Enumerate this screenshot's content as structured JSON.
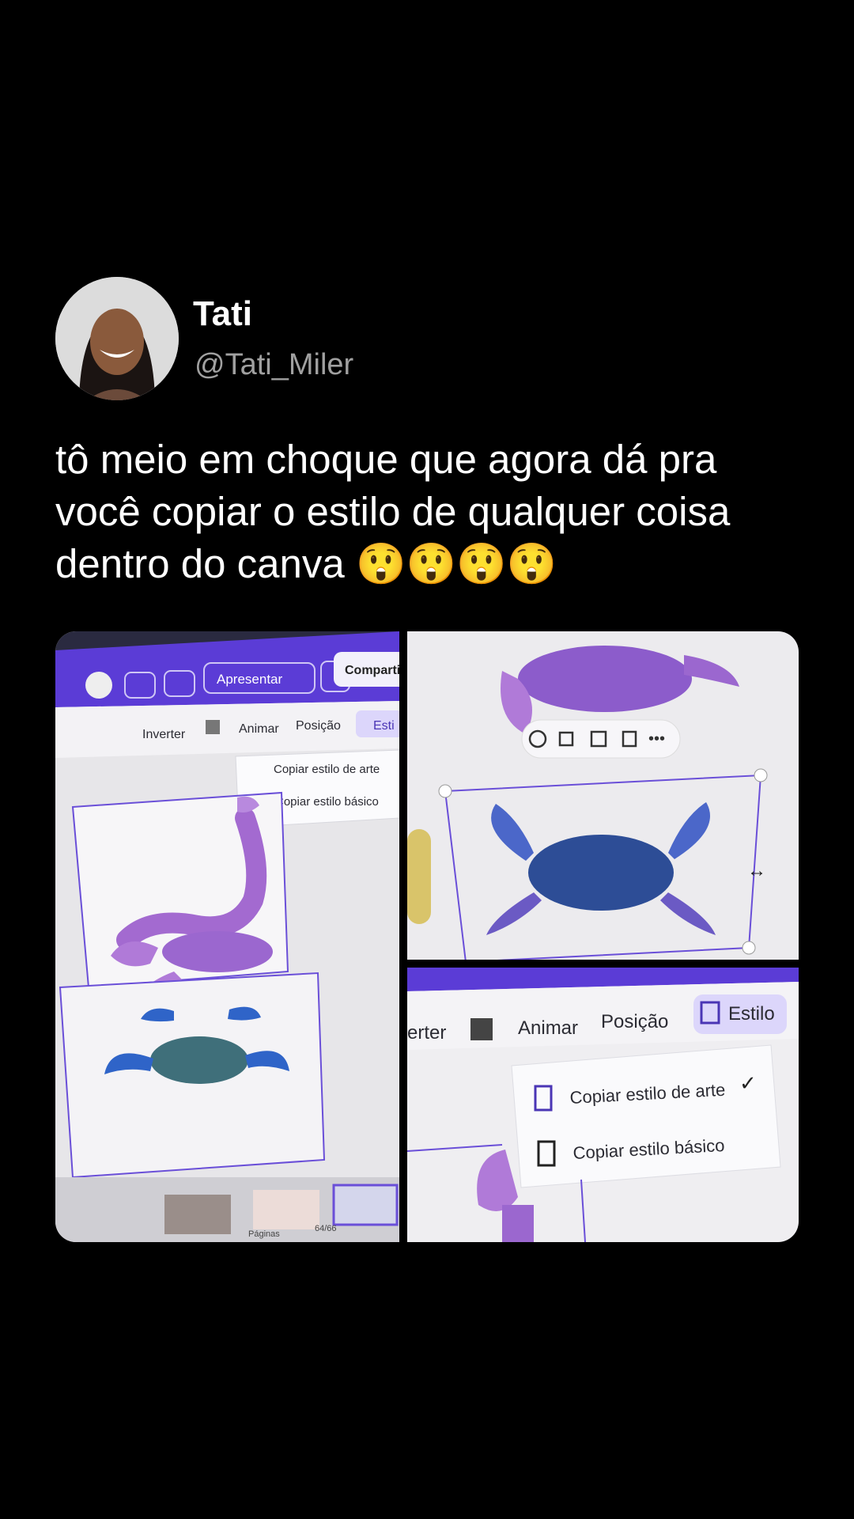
{
  "author": {
    "name": "Tati",
    "handle": "@Tati_Miler"
  },
  "tweet": {
    "text_line1": "tô meio em choque que agora dá pra",
    "text_line2": "você copiar o estilo de qualquer coisa",
    "text_line3": "dentro do canva",
    "emojis": "😲😲😲😲"
  },
  "panel1": {
    "present_button": "Apresentar",
    "share_button": "Compartil",
    "toolbar": {
      "flip": "Inverter",
      "animate": "Animar",
      "position": "Posição",
      "style": "Esti"
    },
    "menu": {
      "copy_art_style": "Copiar estilo de arte",
      "copy_basic_style": "Copiar estilo básico"
    },
    "pages_label": "Páginas",
    "page_count": "64/66"
  },
  "panel3": {
    "toolbar": {
      "flip": "erter",
      "animate": "Animar",
      "position": "Posição",
      "style": "Estilo"
    },
    "menu": {
      "copy_art_style": "Copiar estilo de arte",
      "copy_basic_style": "Copiar estilo básico"
    }
  },
  "colors": {
    "canva_purple": "#5b3cd6",
    "selection_purple": "#6a4fd8",
    "scorpion_purple": "#a36ad0",
    "crab_blue": "#3a5fb8"
  }
}
